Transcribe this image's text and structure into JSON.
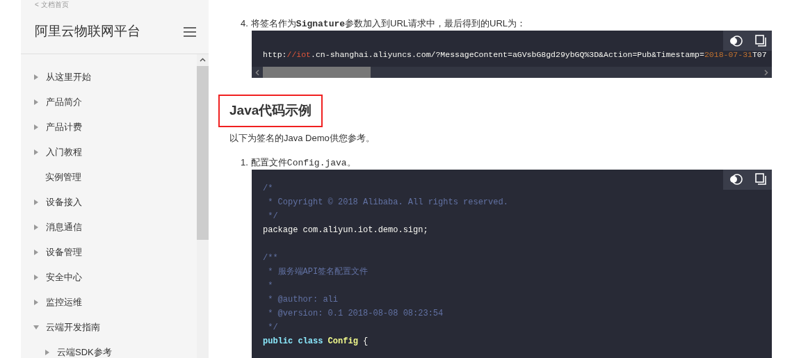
{
  "sidebar": {
    "back_link": "< 文档首页",
    "title": "阿里云物联网平台",
    "items": [
      {
        "label": "从这里开始",
        "kind": "folder",
        "expanded": false
      },
      {
        "label": "产品简介",
        "kind": "folder",
        "expanded": false
      },
      {
        "label": "产品计费",
        "kind": "folder",
        "expanded": false
      },
      {
        "label": "入门教程",
        "kind": "folder",
        "expanded": false
      },
      {
        "label": "实例管理",
        "kind": "page"
      },
      {
        "label": "设备接入",
        "kind": "folder",
        "expanded": false
      },
      {
        "label": "消息通信",
        "kind": "folder",
        "expanded": false
      },
      {
        "label": "设备管理",
        "kind": "folder",
        "expanded": false
      },
      {
        "label": "安全中心",
        "kind": "folder",
        "expanded": false
      },
      {
        "label": "监控运维",
        "kind": "folder",
        "expanded": false
      },
      {
        "label": "云端开发指南",
        "kind": "folder",
        "expanded": true,
        "children": [
          {
            "label": "云端SDK参考",
            "kind": "folder",
            "expanded": false
          }
        ]
      }
    ]
  },
  "content": {
    "step_4": {
      "number": "4.",
      "segments": [
        {
          "text": "将签名作为",
          "kind": "text"
        },
        {
          "text": "Signature",
          "kind": "strong_code"
        },
        {
          "text": "参数加入到URL请求中，最后得到的URL为：",
          "kind": "text"
        }
      ]
    },
    "url_block": {
      "tokens": [
        {
          "text": "http:",
          "kind": "plain"
        },
        {
          "text": "//iot",
          "kind": "link"
        },
        {
          "text": ".cn-shanghai.aliyuncs.com/?MessageContent=aGVsbG8gd29ybGQ%3D&Action=Pub&Timestamp=",
          "kind": "plain"
        },
        {
          "text": "2018-07-31",
          "kind": "number"
        },
        {
          "text": "T07",
          "kind": "plain"
        }
      ]
    },
    "heading": {
      "text": "Java代码示例",
      "highlighted": true
    },
    "paragraph": "以下为签名的Java Demo供您参考。",
    "step_1": {
      "number": "1.",
      "segments": [
        {
          "text": "配置文件",
          "kind": "text"
        },
        {
          "text": "Config.java",
          "kind": "code"
        },
        {
          "text": "。",
          "kind": "text"
        }
      ]
    },
    "code_block": {
      "lines": [
        {
          "kind": "code",
          "tokens": [
            {
              "text": "/*",
              "kind": "comment"
            }
          ]
        },
        {
          "kind": "code",
          "tokens": [
            {
              "text": " * Copyright © 2018 Alibaba. All rights reserved.",
              "kind": "comment"
            }
          ]
        },
        {
          "kind": "code",
          "tokens": [
            {
              "text": " */",
              "kind": "comment"
            }
          ]
        },
        {
          "kind": "code",
          "tokens": [
            {
              "text": "package com.aliyun.iot.demo.sign;",
              "kind": "plain"
            }
          ]
        },
        {
          "kind": "blank"
        },
        {
          "kind": "code",
          "tokens": [
            {
              "text": "/**",
              "kind": "comment"
            }
          ]
        },
        {
          "kind": "code",
          "tokens": [
            {
              "text": " * 服务端API签名配置文件",
              "kind": "comment"
            }
          ]
        },
        {
          "kind": "code",
          "tokens": [
            {
              "text": " *",
              "kind": "comment"
            }
          ]
        },
        {
          "kind": "code",
          "tokens": [
            {
              "text": " * @author: ali",
              "kind": "comment"
            }
          ]
        },
        {
          "kind": "code",
          "tokens": [
            {
              "text": " * @version: 0.1 2018-08-08 08:23:54",
              "kind": "comment"
            }
          ]
        },
        {
          "kind": "code",
          "tokens": [
            {
              "text": " */",
              "kind": "comment"
            }
          ]
        },
        {
          "kind": "code",
          "tokens": [
            {
              "text": "public class",
              "kind": "keyword"
            },
            {
              "text": " Config",
              "kind": "class"
            },
            {
              "text": " {",
              "kind": "plain"
            }
          ]
        }
      ]
    }
  }
}
